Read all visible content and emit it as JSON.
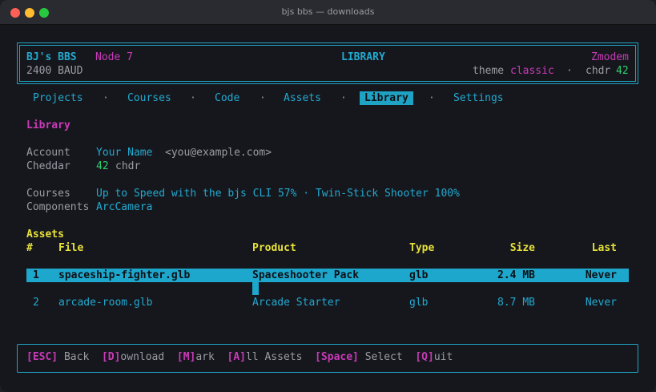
{
  "window": {
    "title": "bjs bbs — downloads"
  },
  "header": {
    "app_name": "BJ's BBS",
    "node": "Node 7",
    "section": "LIBRARY",
    "protocol": "Zmodem",
    "baud": "2400 BAUD",
    "theme_label": "theme",
    "theme_value": "classic",
    "sep": "·",
    "chdr_label": "chdr",
    "chdr_value": "42"
  },
  "tabs": [
    {
      "label": "Projects"
    },
    {
      "label": "Courses"
    },
    {
      "label": "Code"
    },
    {
      "label": "Assets"
    },
    {
      "label": "Library"
    },
    {
      "label": "Settings"
    }
  ],
  "tab_sep": "·",
  "library": {
    "heading": "Library",
    "account_label": "Account",
    "account_name": "Your Name",
    "account_email": "<you@example.com>",
    "cheddar_label": "Cheddar",
    "cheddar_value": "42",
    "cheddar_unit": "chdr",
    "courses_label": "Courses",
    "courses_value": "Up to Speed with the bjs CLI 57% · Twin-Stick Shooter 100%",
    "components_label": "Components",
    "components_value": "ArcCamera"
  },
  "assets": {
    "heading": "Assets",
    "columns": {
      "num": "#",
      "file": "File",
      "product": "Product",
      "type": "Type",
      "size": "Size",
      "last": "Last"
    },
    "rows": [
      {
        "num": "1",
        "file": "spaceship-fighter.glb",
        "product": "Spaceshooter Pack",
        "type": "glb",
        "size": "2.4 MB",
        "last": "Never"
      },
      {
        "num": "2",
        "file": "arcade-room.glb",
        "product": "Arcade Starter",
        "type": "glb",
        "size": "8.7 MB",
        "last": "Never"
      }
    ]
  },
  "footer": {
    "esc_key": "[ESC]",
    "esc_label": " Back",
    "d_key": "[D]",
    "d_label": "ownload",
    "m_key": "[M]",
    "m_label": "ark",
    "a_key": "[A]",
    "a_label": "ll Assets",
    "space_key": "[Space]",
    "space_label": " Select",
    "q_key": "[Q]",
    "q_label": "uit"
  }
}
